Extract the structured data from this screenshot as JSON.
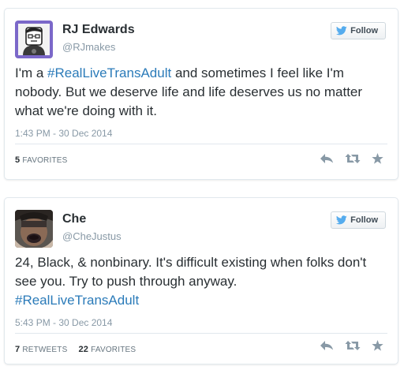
{
  "tweets": [
    {
      "name": "RJ Edwards",
      "handle": "@RJmakes",
      "follow_label": "Follow",
      "text_before": "I'm a ",
      "hashtag": "#RealLiveTransAdult",
      "text_after": " and sometimes I feel like I'm nobody. But we deserve life and life deserves us no matter what we're doing with it.",
      "timestamp": "1:43 PM - 30 Dec 2014",
      "favorites_count": "5",
      "favorites_label": "FAVORITES"
    },
    {
      "name": "Che",
      "handle": "@CheJustus",
      "follow_label": "Follow",
      "text_before": "24, Black, & nonbinary. It's difficult existing when folks don't see you. Try to push through anyway.",
      "hashtag": "#RealLiveTransAdult",
      "text_after": "",
      "timestamp": "5:43 PM - 30 Dec 2014",
      "retweets_count": "7",
      "retweets_label": "RETWEETS",
      "favorites_count": "22",
      "favorites_label": "FAVORITES"
    }
  ],
  "icons": {
    "bird": "twitter-bird-icon",
    "reply": "reply-icon",
    "retweet": "retweet-icon",
    "favorite": "star-icon"
  },
  "colors": {
    "link": "#2b7bb9",
    "text": "#292f33",
    "muted": "#8899a6",
    "bird": "#55acee"
  }
}
